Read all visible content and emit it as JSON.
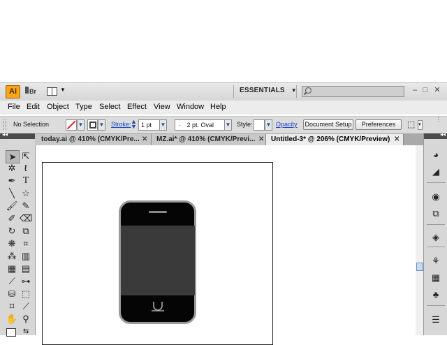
{
  "appbar": {
    "logo": "Ai",
    "bridge_label": "Br",
    "workspace": "ESSENTIALS",
    "window_buttons": [
      "–",
      "□",
      "✕"
    ]
  },
  "menu": [
    "File",
    "Edit",
    "Object",
    "Type",
    "Select",
    "Effect",
    "View",
    "Window",
    "Help"
  ],
  "control": {
    "selection": "No Selection",
    "stroke_label": "Stroke:",
    "stroke_value": "1 pt",
    "brush_value": "2 pt. Oval",
    "style_label": "Style:",
    "opacity_label": "Opacity",
    "document_setup": "Document Setup",
    "preferences": "Preferences"
  },
  "tabs": [
    {
      "label": "today.ai @ 410% (CMYK/Pre..."
    },
    {
      "label": "MZ.ai* @ 410% (CMYK/Previ..."
    },
    {
      "label": "Untitled-3* @ 206% (CMYK/Preview)"
    }
  ],
  "colors": {
    "accent": "#f7a51b",
    "phone_body": "#050505",
    "phone_screen": "#3a3a3a",
    "phone_outline": "#9a9a9a"
  }
}
